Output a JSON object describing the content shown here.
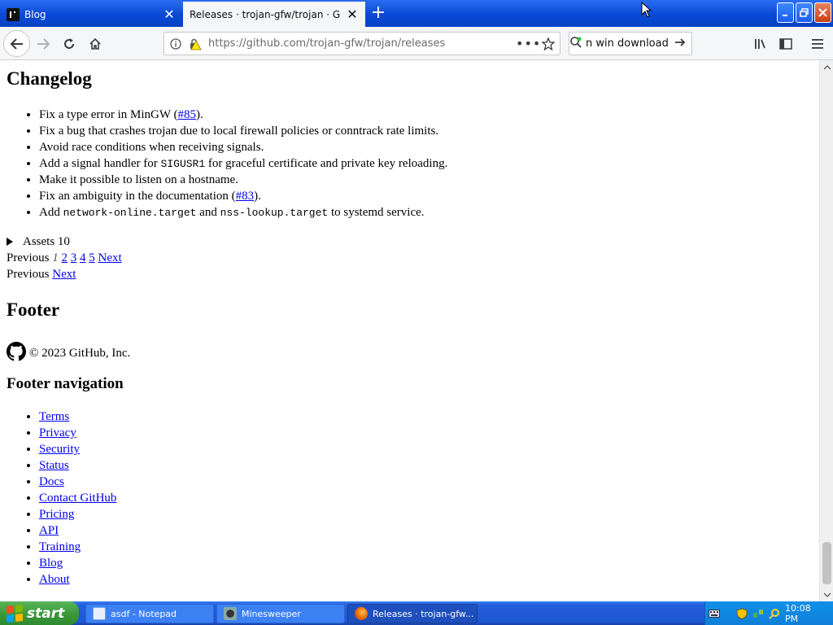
{
  "colors": {
    "titlebar": "#0a49d6",
    "active_tab": "#f5f6f7",
    "link": "#0000ee",
    "taskbar": "#245edb",
    "start_button": "#3c9a3c",
    "tray": "#0f7fd8"
  },
  "browser": {
    "tabs": [
      {
        "label": "Blog",
        "icon": "blog-favicon-icon",
        "close_icon": "close-icon"
      },
      {
        "label": "Releases · trojan-gfw/trojan · GitHub",
        "icon": "",
        "close_icon": "close-icon"
      }
    ],
    "new_tab_icon": "plus-icon",
    "window_buttons": [
      "minimize-icon",
      "restore-icon",
      "close-icon"
    ],
    "nav_icons": [
      "back-arrow-icon",
      "forward-arrow-icon",
      "reload-icon",
      "home-icon"
    ],
    "url": "https://github.com/trojan-gfw/trojan/releases",
    "url_icons": [
      "info-icon",
      "insecure-lock-icon"
    ],
    "page_actions_label": "•••",
    "search_text": "n win download",
    "toolbar_icons": [
      "library-icon",
      "sidebar-icon",
      "hamburger-menu-icon"
    ]
  },
  "page": {
    "changelog_heading": "Changelog",
    "changelog_items": [
      {
        "before": "Fix a type error in MinGW (",
        "link": "#85",
        "after": ")."
      },
      {
        "text": "Fix a bug that crashes trojan due to local firewall policies or conntrack rate limits."
      },
      {
        "text": "Avoid race conditions when receiving signals."
      },
      {
        "before": "Add a signal handler for ",
        "code": "SIGUSR1",
        "after": " for graceful certificate and private key reloading."
      },
      {
        "text": "Make it possible to listen on a hostname."
      },
      {
        "before": "Fix an ambiguity in the documentation (",
        "link": "#83",
        "after": ")."
      },
      {
        "before": "Add ",
        "code": "network-online.target",
        "middle": " and ",
        "code2": "nss-lookup.target",
        "after": " to systemd service."
      }
    ],
    "assets_label": "Assets",
    "assets_count": "10",
    "pagination": {
      "previous": "Previous",
      "current": "1",
      "pages": [
        "2",
        "3",
        "4",
        "5"
      ],
      "next": "Next"
    },
    "prevnext": {
      "previous": "Previous",
      "next": "Next"
    },
    "footer_heading": "Footer",
    "copyright": "© 2023 GitHub, Inc.",
    "footer_nav_heading": "Footer navigation",
    "footer_links": [
      "Terms",
      "Privacy",
      "Security",
      "Status",
      "Docs",
      "Contact GitHub",
      "Pricing",
      "API",
      "Training",
      "Blog",
      "About"
    ]
  },
  "taskbar": {
    "start_label": "start",
    "tasks": [
      {
        "label": "asdf - Notepad",
        "icon": "notepad-icon"
      },
      {
        "label": "Minesweeper",
        "icon": "minesweeper-icon"
      },
      {
        "label": "Releases · trojan-gfw...",
        "icon": "firefox-icon"
      }
    ],
    "tray_icons": [
      "keyboard-icon",
      "shield-icon",
      "network-icon",
      "search-icon"
    ],
    "clock": "10:08 PM"
  }
}
